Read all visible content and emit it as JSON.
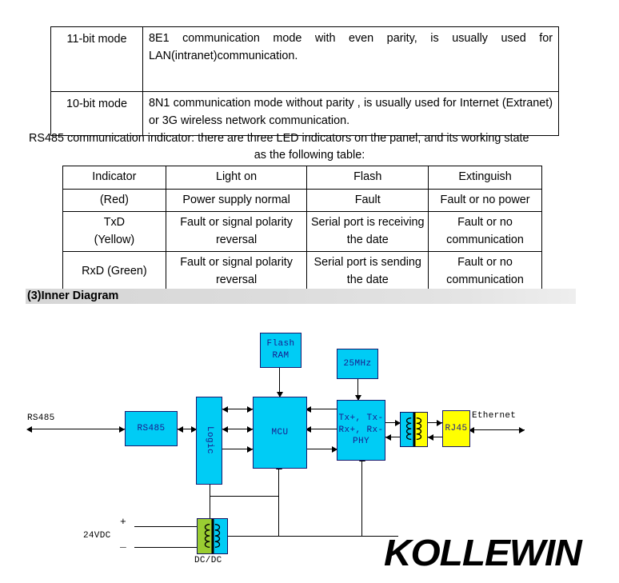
{
  "mode_table": {
    "rows": [
      {
        "mode": "11-bit mode",
        "description": "8E1 communication mode with even parity, is usually used for LAN(intranet)communication."
      },
      {
        "mode": "10-bit mode",
        "description": "8N1 communication mode without parity , is usually used for Internet (Extranet) or 3G wireless network communication."
      }
    ]
  },
  "led_intro": {
    "line1": "RS485 communication indicator: there are three LED indicators on the panel, and its working state",
    "line2": "as the following table:"
  },
  "indicator_table": {
    "headers": [
      "Indicator",
      "Light on",
      "Flash",
      "Extinguish"
    ],
    "rows": [
      {
        "indicator": "(Red)",
        "light_on": "Power supply normal",
        "flash": "Fault",
        "extinguish": "Fault or no power"
      },
      {
        "indicator": "TxD\n(Yellow)",
        "light_on": "Fault or signal polarity reversal",
        "flash": "Serial port is receiving the date",
        "extinguish": "Fault or no communication"
      },
      {
        "indicator": "RxD (Green)",
        "light_on": "Fault or signal polarity reversal",
        "flash": "Serial port is sending the date",
        "extinguish": "Fault or no communication"
      }
    ]
  },
  "section": {
    "heading": "(3)Inner Diagram"
  },
  "diagram": {
    "blocks": {
      "flash_ram": "Flash\nRAM",
      "clock": "25MHz",
      "rs485_block": "RS485",
      "logic": "Logic",
      "mcu": "MCU",
      "phy": "Tx+, Tx-\nRx+, Rx-\nPHY",
      "rj45": "RJ45"
    },
    "labels": {
      "rs485_port": "RS485",
      "ethernet_port": "Ethernet",
      "power_in": "24VDC",
      "power_plus": "+",
      "power_minus": "_",
      "dcdc": "DC/DC"
    },
    "colors": {
      "block_fill": "#00ccf5",
      "block_border": "#1a1a6e",
      "rj45_fill": "#ffff00",
      "dcdc_green": "#9acd32",
      "text": "#1a1a8c"
    }
  },
  "logo": {
    "text": "KOLLEWIN"
  }
}
